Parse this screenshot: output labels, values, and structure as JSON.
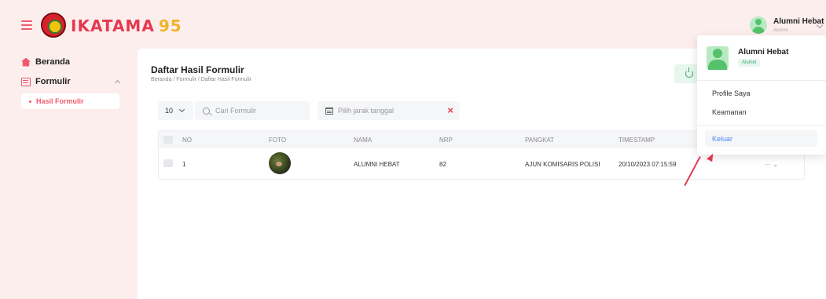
{
  "brand": {
    "name": "IKATAMA",
    "number": "95"
  },
  "user": {
    "name": "Alumni Hebat",
    "role": "Alumni"
  },
  "sidebar": {
    "items": [
      {
        "label": "Beranda"
      },
      {
        "label": "Formulir"
      }
    ],
    "active": "Hasil Formulir"
  },
  "page": {
    "title": "Daftar Hasil Formulir",
    "breadcrumb": "Beranda / Formulir / Daftar Hasil Formulir"
  },
  "controls": {
    "page_length": "10",
    "search_placeholder": "Cari Formulir",
    "date_placeholder": "Pilih jarak tanggal",
    "clear": "×"
  },
  "table": {
    "headers": [
      "NO",
      "FOTO",
      "NAMA",
      "NRP",
      "PANGKAT",
      "TIMESTAMP"
    ],
    "rows": [
      {
        "no": "1",
        "nama": "ALUMNI HEBAT",
        "nrp": "82",
        "pangkat": "AJUN KOMISARIS POLISI",
        "timestamp": "20/10/2023 07:15:59",
        "actions": "··· ⌄"
      }
    ]
  },
  "dropdown": {
    "name": "Alumni Hebat",
    "role": "Alumni",
    "items": [
      "Profile Saya",
      "Keamanan"
    ],
    "logout": "Keluar"
  },
  "colors": {
    "accent": "#ef5b6d",
    "success": "#3aa569",
    "link": "#4b86f5",
    "background": "#fdeeee"
  },
  "icons": [
    "hamburger-icon",
    "home-icon",
    "form-icon",
    "search-icon",
    "calendar-icon",
    "export-icon",
    "chevron-down-icon"
  ]
}
